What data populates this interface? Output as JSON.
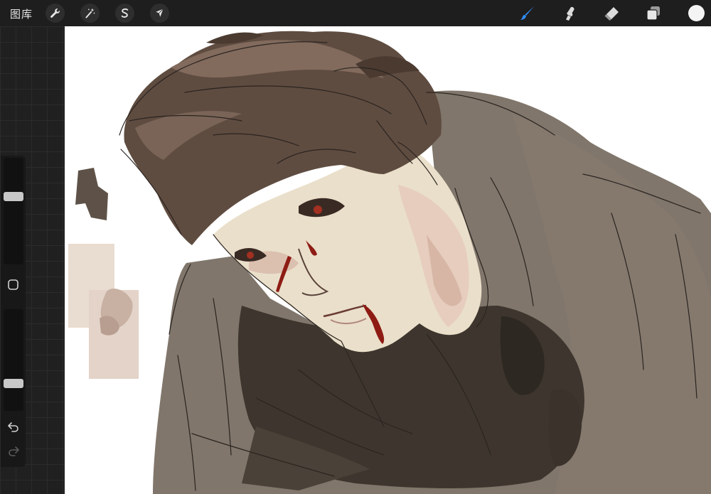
{
  "app": {
    "gallery_label": "图库"
  },
  "toolbar": {
    "left_tools": [
      {
        "name": "actions",
        "icon": "wrench-icon"
      },
      {
        "name": "adjustments",
        "icon": "magic-wand-icon"
      },
      {
        "name": "selection",
        "icon": "selection-s-icon"
      },
      {
        "name": "transform",
        "icon": "arrow-cursor-icon"
      }
    ],
    "right_tools": [
      {
        "name": "brush",
        "icon": "brush-icon",
        "active": true
      },
      {
        "name": "smudge",
        "icon": "smudge-icon",
        "active": false
      },
      {
        "name": "eraser",
        "icon": "eraser-icon",
        "active": false
      },
      {
        "name": "layers",
        "icon": "layers-icon",
        "active": false
      }
    ],
    "current_color": "#f4f4f4",
    "accent_color": "#2f8bf5"
  },
  "sidebar": {
    "brush_size_level": 0.65,
    "opacity_level": 0.25,
    "modify_icon": "square-icon",
    "undo_icon": "undo-icon",
    "redo_icon": "redo-icon"
  },
  "canvas": {
    "artwork": "digital-painting-portrait"
  }
}
